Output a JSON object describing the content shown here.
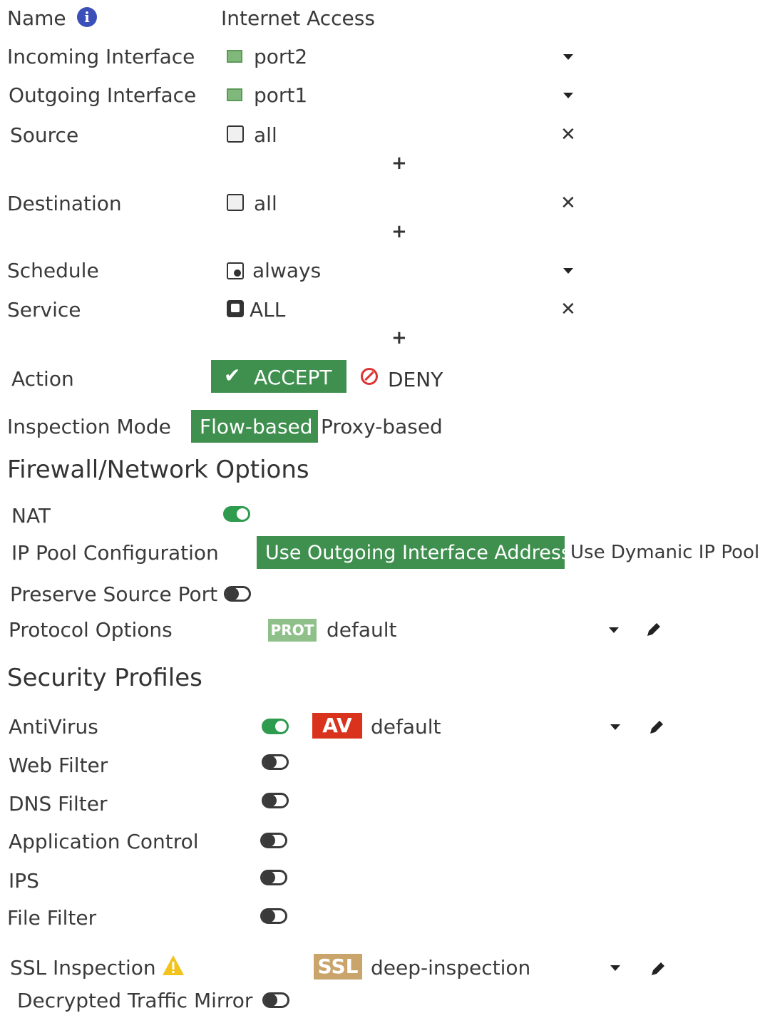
{
  "name": {
    "label": "Name",
    "value": "Internet Access"
  },
  "incoming": {
    "label": "Incoming Interface",
    "value": "port2"
  },
  "outgoing": {
    "label": "Outgoing Interface",
    "value": "port1"
  },
  "source": {
    "label": "Source",
    "value": "all"
  },
  "destination": {
    "label": "Destination",
    "value": "all"
  },
  "schedule": {
    "label": "Schedule",
    "value": "always"
  },
  "service": {
    "label": "Service",
    "value": "ALL"
  },
  "action": {
    "label": "Action",
    "accept": "ACCEPT",
    "deny": "DENY"
  },
  "inspection": {
    "label": "Inspection Mode",
    "flow": "Flow-based",
    "proxy": "Proxy-based"
  },
  "firewall_header": "Firewall/Network Options",
  "nat": {
    "label": "NAT",
    "enabled": true
  },
  "ip_pool": {
    "label": "IP Pool Configuration",
    "outgoing": "Use Outgoing Interface Address",
    "dynamic": "Use Dymanic IP Pool"
  },
  "preserve": {
    "label": "Preserve Source Port",
    "enabled": false
  },
  "protocol": {
    "label": "Protocol Options",
    "badge": "PROT",
    "value": "default"
  },
  "security_header": "Security Profiles",
  "antivirus": {
    "label": "AntiVirus",
    "enabled": true,
    "badge": "AV",
    "value": "default"
  },
  "webfilter": {
    "label": "Web Filter",
    "enabled": false
  },
  "dnsfilter": {
    "label": "DNS Filter",
    "enabled": false
  },
  "appcontrol": {
    "label": "Application Control",
    "enabled": false
  },
  "ips": {
    "label": "IPS",
    "enabled": false
  },
  "filefilter": {
    "label": "File Filter",
    "enabled": false
  },
  "ssl": {
    "label": "SSL Inspection",
    "badge": "SSL",
    "value": "deep-inspection"
  },
  "mirror": {
    "label": "Decrypted Traffic Mirror",
    "enabled": false
  },
  "colors": {
    "accept_green": "#3f8f4f",
    "toggle_on": "#2f9b4f",
    "av_red": "#d9331e",
    "ssl_tan": "#c9a46b",
    "prot_green": "#7fb87a",
    "info_blue": "#3b4fb8",
    "deny_red": "#d33"
  }
}
